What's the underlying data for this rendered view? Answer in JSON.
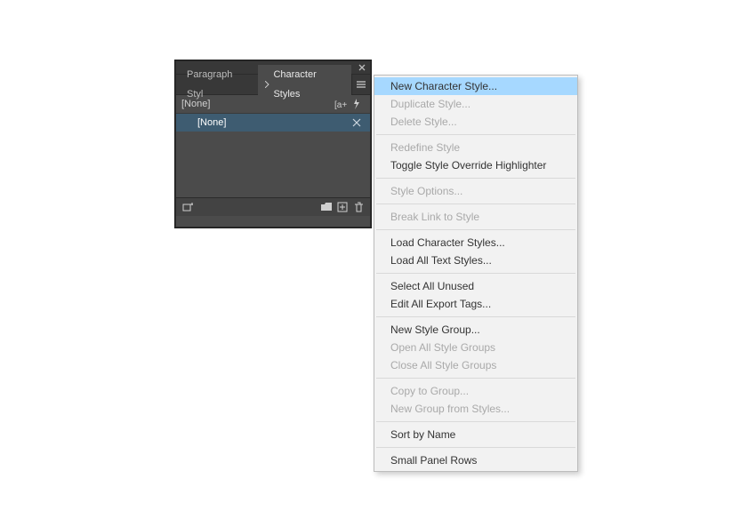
{
  "panel": {
    "tabs": {
      "paragraph": "Paragraph Styl",
      "character": "Character Styles"
    },
    "header_label": "[None]",
    "selected_style": "[None]"
  },
  "menu": {
    "new_char_style": "New Character Style...",
    "duplicate_style": "Duplicate Style...",
    "delete_style": "Delete Style...",
    "redefine_style": "Redefine Style",
    "toggle_override": "Toggle Style Override Highlighter",
    "style_options": "Style Options...",
    "break_link": "Break Link to Style",
    "load_char_styles": "Load Character Styles...",
    "load_all_text": "Load All Text Styles...",
    "select_unused": "Select All Unused",
    "edit_export_tags": "Edit All Export Tags...",
    "new_style_group": "New Style Group...",
    "open_all_groups": "Open All Style Groups",
    "close_all_groups": "Close All Style Groups",
    "copy_to_group": "Copy to Group...",
    "new_group_from": "New Group from Styles...",
    "sort_by_name": "Sort by Name",
    "small_panel_rows": "Small Panel Rows"
  }
}
